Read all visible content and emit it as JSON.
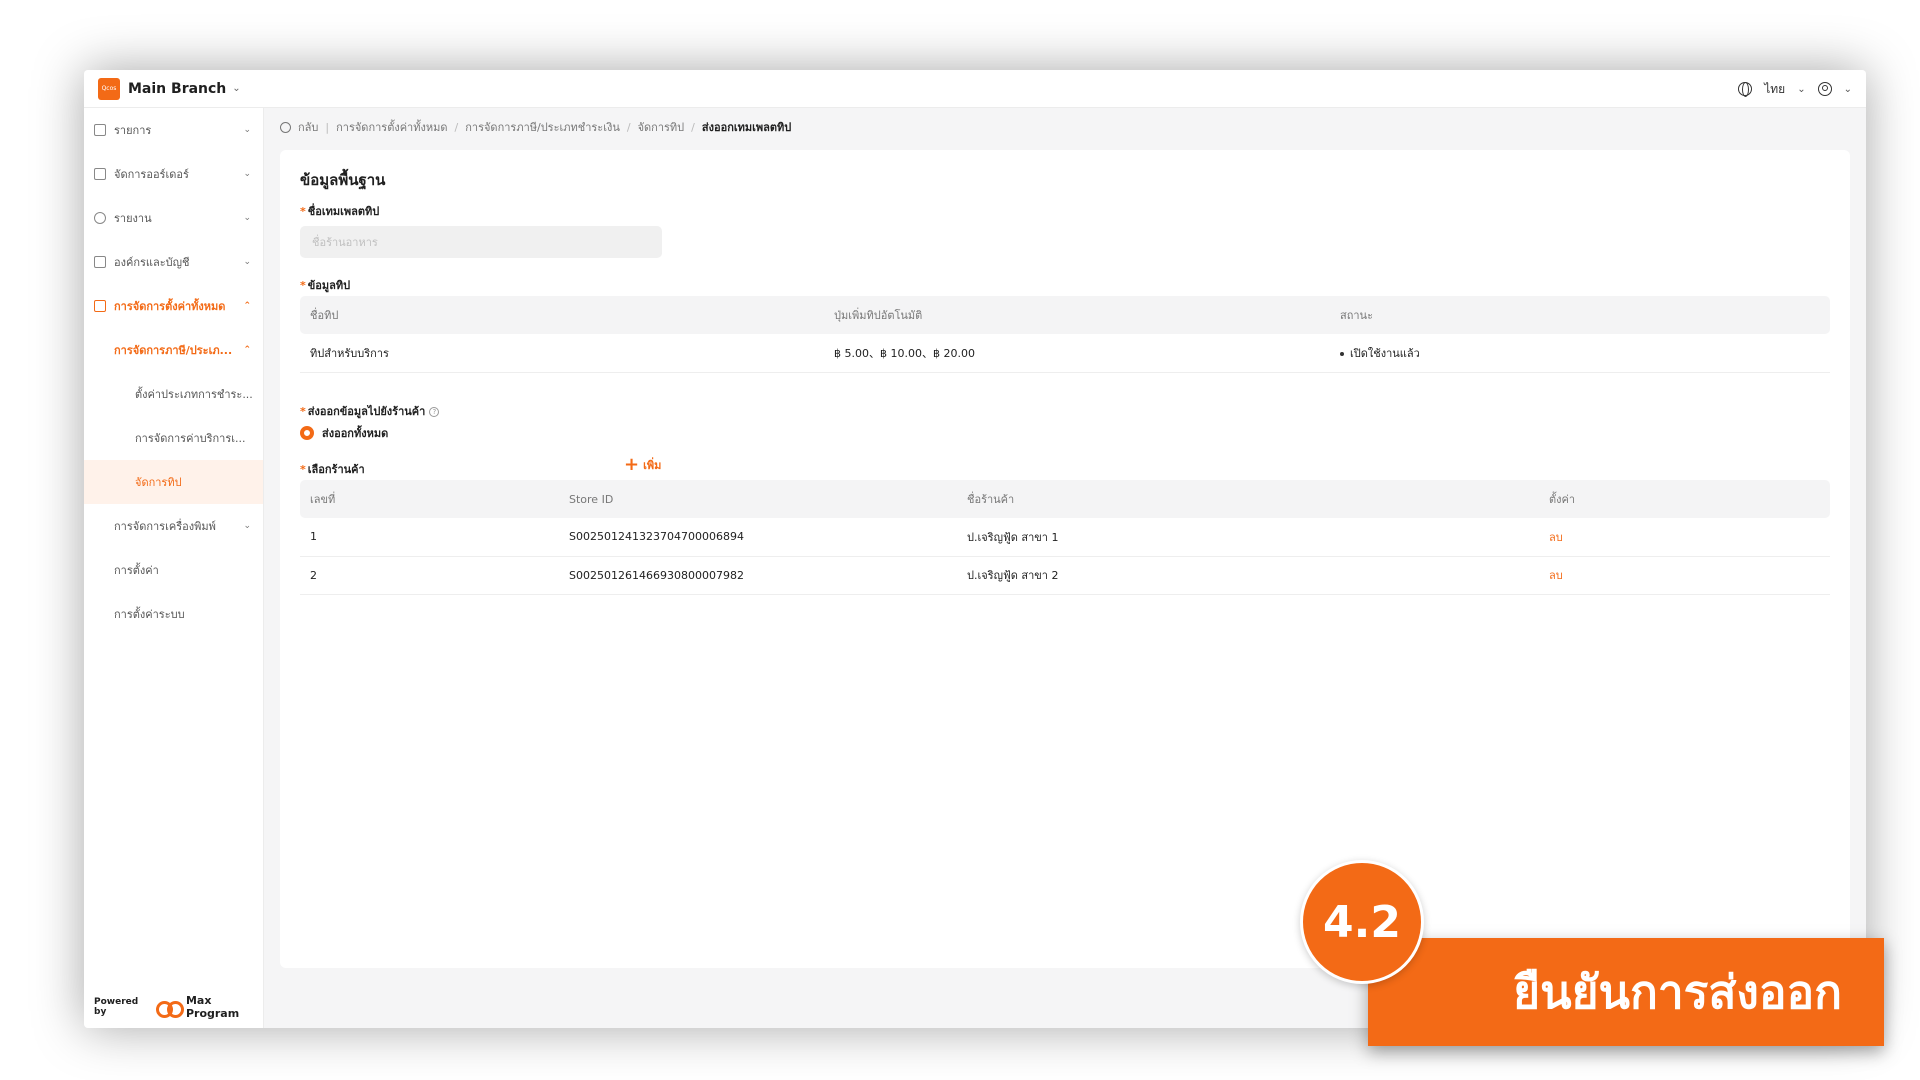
{
  "topbar": {
    "logo_text": "Qcos",
    "branch_name": "Main Branch",
    "language": "ไทย"
  },
  "sidebar": {
    "items": [
      {
        "label": "รายการ"
      },
      {
        "label": "จัดการออร์เดอร์"
      },
      {
        "label": "รายงาน"
      },
      {
        "label": "องค์กรและบัญชี"
      },
      {
        "label": "การจัดการตั้งค่าทั้งหมด"
      },
      {
        "label": "การจัดการภาษี/ประเภ..."
      },
      {
        "label": "ตั้งค่าประเภทการชำระ..."
      },
      {
        "label": "การจัดการค่าบริการเ..."
      },
      {
        "label": "จัดการทิป"
      },
      {
        "label": "การจัดการเครื่องพิมพ์"
      },
      {
        "label": "การตั้งค่า"
      },
      {
        "label": "การตั้งค่าระบบ"
      }
    ],
    "powered_by": "Powered by",
    "brand": "Max Program"
  },
  "breadcrumb": {
    "back": "กลับ",
    "items": [
      "การจัดการตั้งค่าทั้งหมด",
      "การจัดการภาษี/ประเภทชำระเงิน",
      "จัดการทิป",
      "ส่งออกเทมเพลตทิป"
    ]
  },
  "form": {
    "section_title": "ข้อมูลพื้นฐาน",
    "template_name_label": "ชื่อเทมเพลตทิป",
    "template_name_placeholder": "ชื่อร้านอาหาร",
    "tip_info_label": "ข้อมูลทิป",
    "tip_table": {
      "headers": [
        "ชื่อทิป",
        "ปุ่มเพิ่มทิปอัตโนมัติ",
        "สถานะ"
      ],
      "rows": [
        {
          "name": "ทิปสำหรับบริการ",
          "buttons": "฿ 5.00、฿ 10.00、฿ 20.00",
          "status": "เปิดใช้งานแล้ว"
        }
      ]
    },
    "export_label": "ส่งออกข้อมูลไปยังร้านค้า",
    "export_option": "ส่งออกทั้งหมด",
    "select_store_label": "เลือกร้านค้า",
    "add_label": "เพิ่ม",
    "store_table": {
      "headers": [
        "เลขที่",
        "Store ID",
        "ชื่อร้านค้า",
        "ตั้งค่า"
      ],
      "rows": [
        {
          "no": "1",
          "store_id": "S002501241323704700006894",
          "name": "ป.เจริญฟู้ด สาขา 1",
          "action": "ลบ"
        },
        {
          "no": "2",
          "store_id": "S002501261466930800007982",
          "name": "ป.เจริญฟู้ด สาขา 2",
          "action": "ลบ"
        }
      ]
    }
  },
  "annotation": {
    "step": "4.2",
    "caption": "ยืนยันการส่งออก"
  },
  "colors": {
    "accent": "#f36a16",
    "background": "#f5f5f6"
  }
}
